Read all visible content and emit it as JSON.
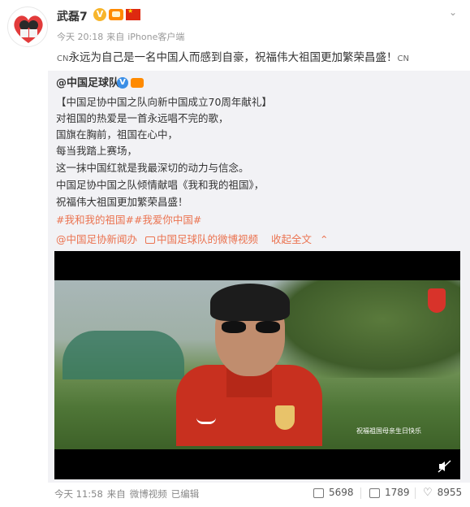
{
  "post": {
    "username": "武磊7",
    "meta_time": "今天 20:18",
    "meta_from": "来自",
    "meta_source": "iPhone客户端",
    "text_prefix": "CN",
    "text": "永远为自己是一名中国人而感到自豪，祝福伟大祖国更加繁荣昌盛！",
    "text_suffix": "CN"
  },
  "repost": {
    "author": "@中国足球队",
    "lines": [
      "【中国足协中国之队向新中国成立70周年献礼】",
      "对祖国的热爱是一首永远唱不完的歌，",
      "国旗在胸前，祖国在心中，",
      "每当我踏上赛场，",
      "这一抹中国红就是我最深切的动力与信念。",
      "中国足协中国之队倾情献唱《我和我的祖国》，",
      "祝福伟大祖国更加繁荣昌盛！"
    ],
    "hashtags": "#我和我的祖国##我爱你中国#",
    "link_source": "@中国足协新闻办",
    "link_video": "中国足球队的微博视频",
    "link_collapse": "收起全文",
    "video_caption": "祝福祖国母亲生日快乐",
    "footer_time": "今天 11:58",
    "footer_from": "来自",
    "footer_source": "微博视频",
    "footer_edited": "已编辑"
  },
  "stats": {
    "repost_count": "5698",
    "comment_count": "1789",
    "like_count": "8955"
  },
  "icons": {
    "chevron": "chevron-down-icon",
    "verified": "verified-badge-icon",
    "vip": "vip-badge-icon",
    "flag": "china-flag-icon",
    "mute": "mute-icon",
    "repost": "repost-icon",
    "comment": "comment-icon",
    "like": "like-icon"
  },
  "colors": {
    "link": "#eb7350",
    "repost_bg": "#f2f2f5",
    "verified_gold": "#f7b52c",
    "verified_blue": "#3a8ee6"
  }
}
